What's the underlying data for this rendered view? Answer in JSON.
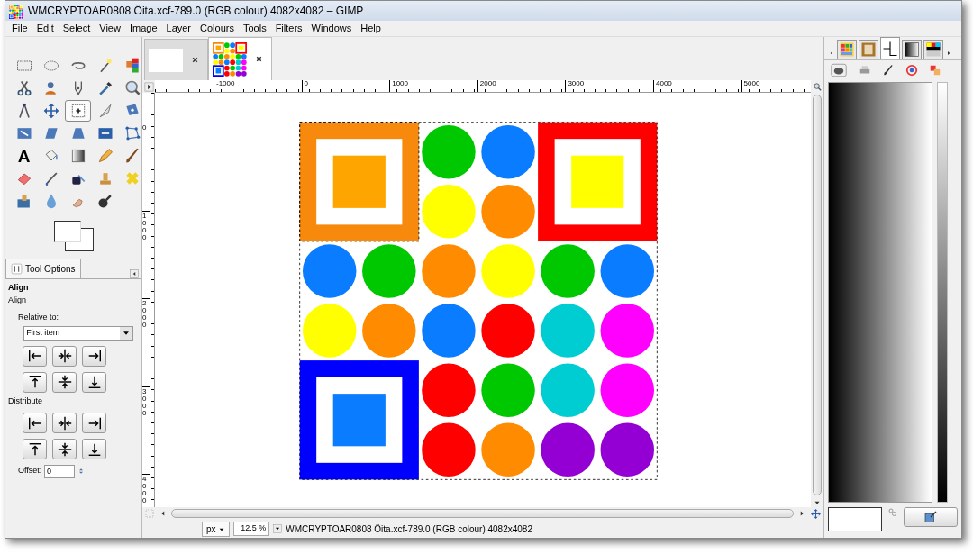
{
  "window": {
    "title": "WMCRYPTOAR0808 Öita.xcf-789.0 (RGB colour) 4082x4082 – GIMP"
  },
  "menu": [
    "File",
    "Edit",
    "Select",
    "View",
    "Image",
    "Layer",
    "Colours",
    "Tools",
    "Filters",
    "Windows",
    "Help"
  ],
  "toolbox": {
    "tools": [
      {
        "selected": false
      },
      {
        "selected": false
      },
      {
        "selected": false
      },
      {
        "selected": false
      },
      {
        "selected": false
      },
      {
        "selected": false
      },
      {
        "selected": false
      },
      {
        "selected": false
      },
      {
        "selected": false
      },
      {
        "selected": false
      },
      {
        "selected": false
      },
      {
        "selected": false
      },
      {
        "selected": true
      },
      {
        "selected": false
      },
      {
        "selected": false
      },
      {
        "selected": false
      },
      {
        "selected": false
      },
      {
        "selected": false
      },
      {
        "selected": false
      },
      {
        "selected": false
      },
      {
        "selected": false,
        "glyph": "A"
      },
      {
        "selected": false
      },
      {
        "selected": false
      },
      {
        "selected": false
      },
      {
        "selected": false
      },
      {
        "selected": false
      },
      {
        "selected": false
      },
      {
        "selected": false
      },
      {
        "selected": false
      },
      {
        "selected": false
      },
      {
        "selected": false
      },
      {
        "selected": false
      },
      {
        "selected": false
      },
      {
        "selected": false
      }
    ]
  },
  "tool_options": {
    "tab": "Tool Options",
    "title": "Align",
    "section": "Align",
    "relative_label": "Relative to:",
    "relative_value": "First item",
    "distribute_label": "Distribute",
    "offset_label": "Offset:",
    "offset_value": "0"
  },
  "image_tabs": [
    {
      "kind": "blank",
      "selected": false
    },
    {
      "kind": "image",
      "selected": true
    }
  ],
  "rulers": {
    "horizontal": [
      "-1000",
      "0",
      "1000",
      "2000",
      "3000",
      "4000",
      "5000"
    ],
    "vertical": [
      "0",
      "1000",
      "2000",
      "3000",
      "4000"
    ]
  },
  "status": {
    "unit": "px",
    "zoom": "12.5 %",
    "text": "WMCRYPTOAR0808 Öita.xcf-789.0 (RGB colour) 4082x4082"
  },
  "dock": {
    "tabs": [
      {
        "selected": false
      },
      {
        "selected": false
      },
      {
        "selected": true
      },
      {
        "selected": false
      },
      {
        "selected": false
      }
    ]
  }
}
